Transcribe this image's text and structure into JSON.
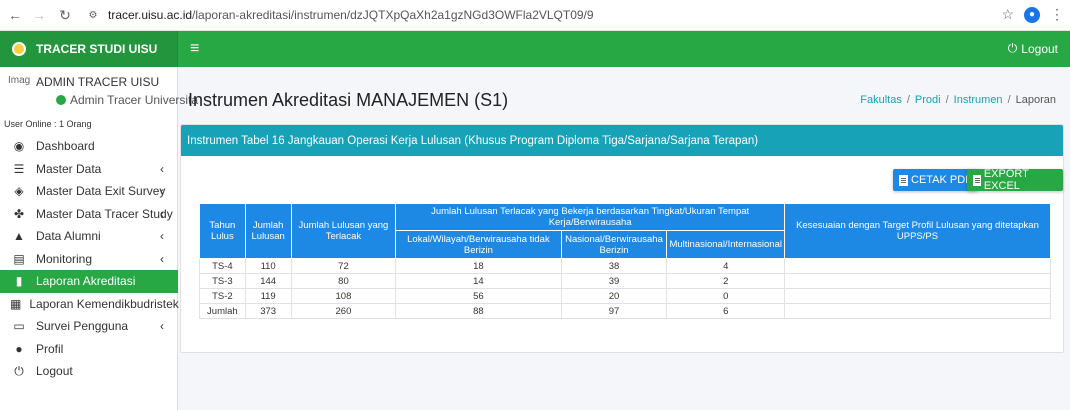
{
  "browser": {
    "url_host": "tracer.uisu.ac.id",
    "url_path": "/laporan-akreditasi/instrumen/dzJQTXpQaXh2a1gzNGd3OWFla2VLQT09/9"
  },
  "topbar": {
    "brand": "TRACER STUDI UISU",
    "logout": "Logout"
  },
  "sidebar": {
    "user_image_alt": "Image",
    "user_name": "ADMIN TRACER UISU",
    "user_role": "Admin Tracer Universita",
    "online": "User Online : 1 Orang",
    "items": [
      {
        "label": "Dashboard",
        "icon": "dashboard-icon",
        "caret": ""
      },
      {
        "label": "Master Data",
        "icon": "database-icon",
        "caret": "‹"
      },
      {
        "label": "Master Data Exit Survey",
        "icon": "survey-icon",
        "caret": "‹"
      },
      {
        "label": "Master Data Tracer Study",
        "icon": "people-icon",
        "caret": "‹"
      },
      {
        "label": "Data Alumni",
        "icon": "graduation-cap-icon",
        "caret": "‹"
      },
      {
        "label": "Monitoring",
        "icon": "list-icon",
        "caret": "‹"
      },
      {
        "label": "Laporan Akreditasi",
        "icon": "chart-icon",
        "caret": ""
      },
      {
        "label": "Laporan Kemendikbudristek",
        "icon": "building-icon",
        "caret": ""
      },
      {
        "label": "Survei Pengguna",
        "icon": "laptop-icon",
        "caret": "‹"
      },
      {
        "label": "Profil",
        "icon": "user-icon",
        "caret": ""
      },
      {
        "label": "Logout",
        "icon": "power-icon",
        "caret": ""
      }
    ]
  },
  "page": {
    "title": "Instrumen Akreditasi MANAJEMEN (S1)",
    "breadcrumb": {
      "b1": "Fakultas",
      "b2": "Prodi",
      "b3": "Instrumen",
      "b4": "Laporan"
    }
  },
  "card": {
    "header": "Instrumen Tabel 16 Jangkauan Operasi Kerja Lulusan (Khusus Program Diploma Tiga/Sarjana/Sarjana Terapan)",
    "btn_pdf": "CETAK PDF",
    "btn_excel": "EXPORT EXCEL"
  },
  "table": {
    "h_tahun": "Tahun Lulus",
    "h_jumlah": "Jumlah Lulusan",
    "h_terlacak": "Jumlah Lulusan yang Terlacak",
    "h_group": "Jumlah Lulusan Terlacak yang Bekerja berdasarkan Tingkat/Ukuran Tempat Kerja/Berwirausaha",
    "h_lokal": "Lokal/Wilayah/Berwirausaha tidak Berizin",
    "h_nasional": "Nasional/Berwirausaha Berizin",
    "h_multi": "Multinasional/Internasional",
    "h_kesesuaian": "Kesesuaian dengan Target Profil Lulusan yang ditetapkan UPPS/PS",
    "rows": [
      [
        "TS-4",
        "110",
        "72",
        "18",
        "38",
        "4",
        ""
      ],
      [
        "TS-3",
        "144",
        "80",
        "14",
        "39",
        "2",
        ""
      ],
      [
        "TS-2",
        "119",
        "108",
        "56",
        "20",
        "0",
        ""
      ],
      [
        "Jumlah",
        "373",
        "260",
        "88",
        "97",
        "6",
        ""
      ]
    ]
  }
}
